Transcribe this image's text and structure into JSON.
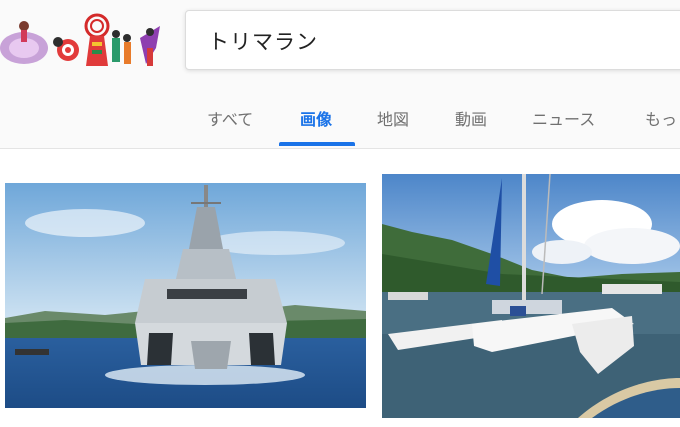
{
  "search": {
    "query": "トリマラン"
  },
  "tabs": [
    {
      "label": "すべて",
      "active": false
    },
    {
      "label": "画像",
      "active": true
    },
    {
      "label": "地図",
      "active": false
    },
    {
      "label": "動画",
      "active": false
    },
    {
      "label": "ニュース",
      "active": false
    },
    {
      "label": "もっ",
      "active": false
    }
  ],
  "colors": {
    "accent": "#1a73e8",
    "tab_text": "#707070"
  }
}
